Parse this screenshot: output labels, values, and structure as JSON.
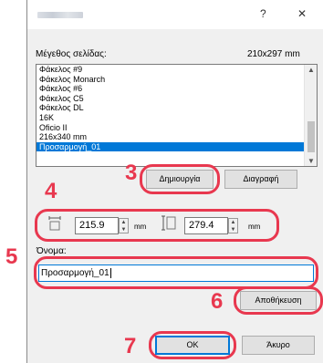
{
  "titlebar": {
    "help_label": "?",
    "close_label": "✕"
  },
  "paper_size": {
    "label": "Μέγεθος σελίδας:",
    "value": "210x297 mm",
    "items": [
      "Φάκελος #9",
      "Φάκελος Monarch",
      "Φάκελος #6",
      "Φάκελος C5",
      "Φάκελος DL",
      "16K",
      "Oficio II",
      "216x340 mm",
      "Προσαρμογή_01"
    ],
    "selected": "Προσαρμογή_01"
  },
  "buttons": {
    "create": "Δημιουργία",
    "delete": "Διαγραφή",
    "save": "Αποθήκευση",
    "ok": "OK",
    "cancel": "Άκυρο"
  },
  "dimensions": {
    "width_value": "215.9",
    "height_value": "279.4",
    "unit": "mm"
  },
  "name_field": {
    "label": "Όνομα:",
    "value": "Προσαρμογή_01"
  },
  "steps": {
    "s3": "3",
    "s4": "4",
    "s5": "5",
    "s6": "6",
    "s7": "7"
  },
  "colors": {
    "highlight": "#e8384f",
    "selection": "#0078d7"
  }
}
